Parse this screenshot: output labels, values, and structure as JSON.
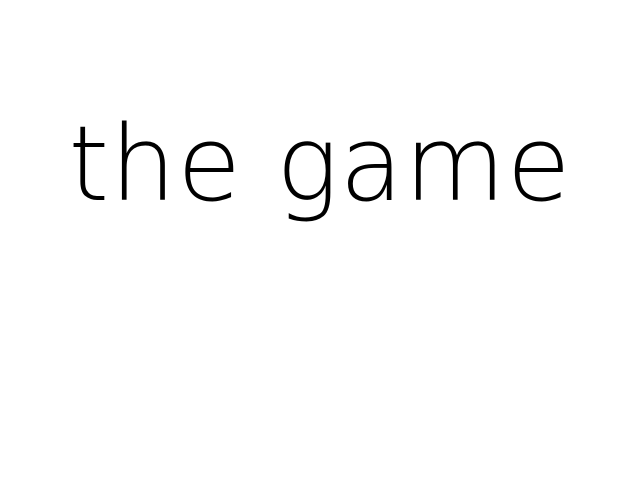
{
  "screen": {
    "title": "the game",
    "background_color": "#ffffff",
    "text_color": "#000000"
  }
}
